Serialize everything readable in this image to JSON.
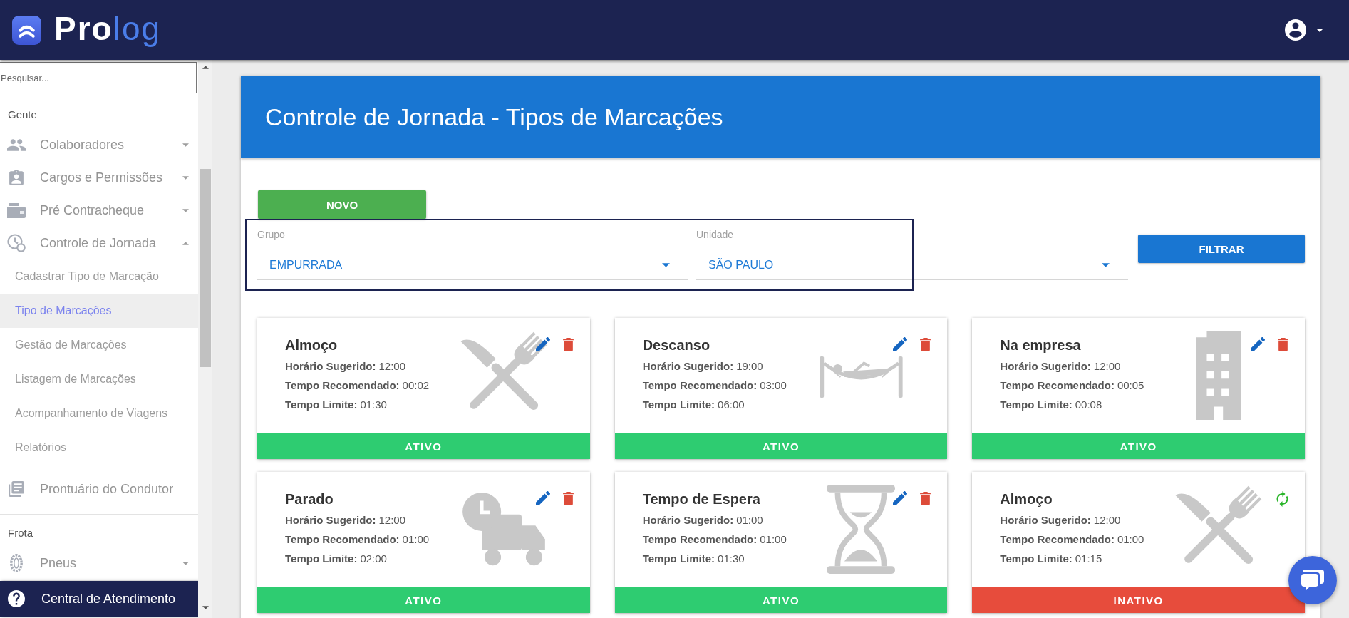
{
  "header": {
    "logo": {
      "text": "Pro",
      "accent": "log"
    }
  },
  "sidebar": {
    "search": {
      "placeholder": "Pesquisar..."
    },
    "sections": [
      {
        "title": "Gente",
        "items": [
          {
            "label": "Colaboradores",
            "kind": "menu",
            "expanded": false
          },
          {
            "label": "Cargos e Permissões",
            "kind": "menu",
            "expanded": false
          },
          {
            "label": "Pré Contracheque",
            "kind": "menu",
            "expanded": false
          },
          {
            "label": "Controle de Jornada",
            "kind": "menu",
            "expanded": true,
            "children": [
              {
                "label": "Cadastrar Tipo de Marcação",
                "selected": false
              },
              {
                "label": "Tipo de Marcações",
                "selected": true
              },
              {
                "label": "Gestão de Marcações",
                "selected": false
              },
              {
                "label": "Listagem de Marcações",
                "selected": false
              },
              {
                "label": "Acompanhamento de Viagens",
                "selected": false
              },
              {
                "label": "Relatórios",
                "selected": false
              }
            ]
          },
          {
            "label": "Prontuário do Condutor",
            "kind": "link"
          }
        ]
      },
      {
        "title": "Frota",
        "items": [
          {
            "label": "Pneus",
            "kind": "menu",
            "expanded": false
          }
        ]
      }
    ],
    "support": {
      "label": "Central de Atendimento"
    }
  },
  "main": {
    "title": "Controle de Jornada - Tipos de Marcações",
    "new_button": "NOVO",
    "filters": [
      {
        "label": "Grupo",
        "value": "EMPURRADA"
      },
      {
        "label": "Unidade",
        "value": "SÃO PAULO"
      }
    ],
    "filter_button": "FILTRAR",
    "cards": [
      {
        "title": "Almoço",
        "kind": "meal",
        "fields": [
          {
            "label": "Horário Sugerido:",
            "value": "12:00"
          },
          {
            "label": "Tempo Recomendado:",
            "value": "00:02"
          },
          {
            "label": "Tempo Limite:",
            "value": "01:30"
          }
        ],
        "active": true,
        "status": "ATIVO"
      },
      {
        "title": "Descanso",
        "kind": "rest",
        "fields": [
          {
            "label": "Horário Sugerido:",
            "value": "19:00"
          },
          {
            "label": "Tempo Recomendado:",
            "value": "03:00"
          },
          {
            "label": "Tempo Limite:",
            "value": "06:00"
          }
        ],
        "active": true,
        "status": "ATIVO"
      },
      {
        "title": "Na empresa",
        "kind": "office",
        "fields": [
          {
            "label": "Horário Sugerido:",
            "value": "12:00"
          },
          {
            "label": "Tempo Recomendado:",
            "value": "00:05"
          },
          {
            "label": "Tempo Limite:",
            "value": "00:08"
          }
        ],
        "active": true,
        "status": "ATIVO"
      },
      {
        "title": "Parado",
        "kind": "stop",
        "fields": [
          {
            "label": "Horário Sugerido:",
            "value": "12:00"
          },
          {
            "label": "Tempo Recomendado:",
            "value": "01:00"
          },
          {
            "label": "Tempo Limite:",
            "value": "02:00"
          }
        ],
        "active": true,
        "status": "ATIVO"
      },
      {
        "title": "Tempo de Espera",
        "kind": "wait",
        "fields": [
          {
            "label": "Horário Sugerido:",
            "value": "01:00"
          },
          {
            "label": "Tempo Recomendado:",
            "value": "01:00"
          },
          {
            "label": "Tempo Limite:",
            "value": "01:30"
          }
        ],
        "active": true,
        "status": "ATIVO"
      },
      {
        "title": "Almoço",
        "kind": "meal",
        "fields": [
          {
            "label": "Horário Sugerido:",
            "value": "12:00"
          },
          {
            "label": "Tempo Recomendado:",
            "value": "01:00"
          },
          {
            "label": "Tempo Limite:",
            "value": "01:15"
          }
        ],
        "active": false,
        "status": "INATIVO"
      }
    ]
  }
}
